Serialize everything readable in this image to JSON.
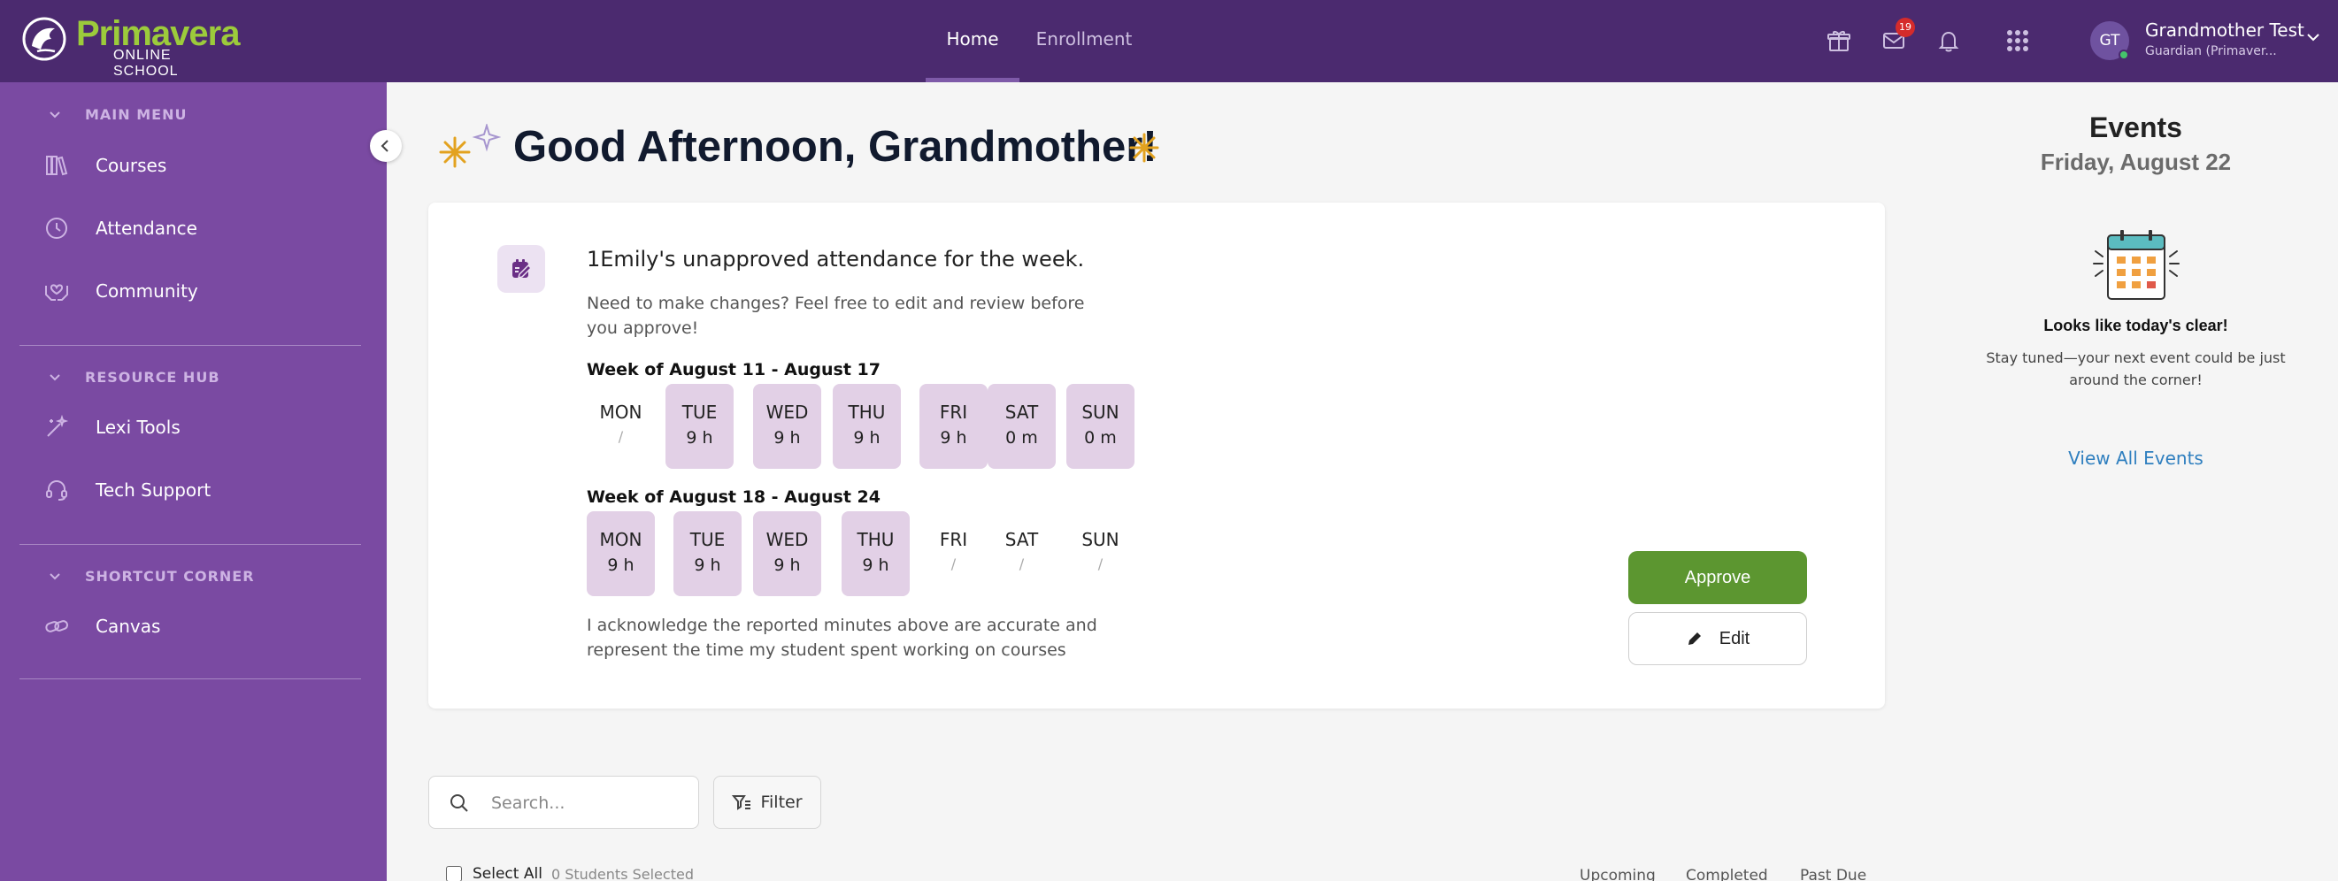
{
  "brand": {
    "name": "Primavera",
    "subtitle": "ONLINE SCHOOL",
    "primary_color": "#4b2a6f",
    "sidebar_color": "#7a4aa2",
    "accent_green": "#9ccb3b",
    "approve_color": "#5c9630"
  },
  "topnav": {
    "tabs": [
      {
        "label": "Home",
        "active": true
      },
      {
        "label": "Enrollment",
        "active": false
      }
    ],
    "mail_badge": "19",
    "icons": [
      "gift-icon",
      "mail-icon",
      "bell-icon",
      "apps-grid-icon"
    ]
  },
  "user": {
    "initials": "GT",
    "name": "Grandmother Test",
    "role": "Guardian (Primaver..."
  },
  "sidebar": {
    "sections": [
      {
        "title": "MAIN MENU",
        "items": [
          {
            "label": "Courses",
            "icon": "books-icon"
          },
          {
            "label": "Attendance",
            "icon": "clock-icon"
          },
          {
            "label": "Community",
            "icon": "hands-heart-icon"
          }
        ]
      },
      {
        "title": "RESOURCE HUB",
        "items": [
          {
            "label": "Lexi Tools",
            "icon": "magic-wand-icon"
          },
          {
            "label": "Tech Support",
            "icon": "headset-icon"
          }
        ]
      },
      {
        "title": "SHORTCUT CORNER",
        "items": [
          {
            "label": "Canvas",
            "icon": "link-icon"
          }
        ]
      }
    ]
  },
  "greeting": "Good Afternoon, Grandmother!",
  "attendance": {
    "title": "1Emily's unapproved attendance for the week.",
    "description": "Need to make changes?  Feel free to edit and review before you approve!",
    "weeks": [
      {
        "label": "Week of August 11 - August 17",
        "days": [
          {
            "day": "MON",
            "value": "/",
            "filled": false
          },
          {
            "day": "TUE",
            "value": "9 h",
            "filled": true
          },
          {
            "day": "WED",
            "value": "9 h",
            "filled": true
          },
          {
            "day": "THU",
            "value": "9 h",
            "filled": true
          },
          {
            "day": "FRI",
            "value": "9 h",
            "filled": true
          },
          {
            "day": "SAT",
            "value": "0 m",
            "filled": true
          },
          {
            "day": "SUN",
            "value": "0 m",
            "filled": true
          }
        ]
      },
      {
        "label": "Week of August 18 - August 24",
        "days": [
          {
            "day": "MON",
            "value": "9 h",
            "filled": true
          },
          {
            "day": "TUE",
            "value": "9 h",
            "filled": true
          },
          {
            "day": "WED",
            "value": "9 h",
            "filled": true
          },
          {
            "day": "THU",
            "value": "9 h",
            "filled": true
          },
          {
            "day": "FRI",
            "value": "/",
            "filled": false
          },
          {
            "day": "SAT",
            "value": "/",
            "filled": false
          },
          {
            "day": "SUN",
            "value": "/",
            "filled": false
          }
        ]
      }
    ],
    "acknowledgement": "I acknowledge the reported minutes above are accurate and represent the time my student spent working on courses",
    "approve_label": "Approve",
    "edit_label": "Edit"
  },
  "events": {
    "title": "Events",
    "date": "Friday, August 22",
    "empty_title": "Looks like today's clear!",
    "empty_text": "Stay tuned—your next event could be just around the corner!",
    "view_all": "View All Events"
  },
  "search": {
    "placeholder": "Search..."
  },
  "filter_label": "Filter",
  "selection": {
    "select_all": "Select All",
    "count": "0 Students Selected"
  },
  "status_tabs": [
    "Upcoming",
    "Completed",
    "Past Due"
  ]
}
